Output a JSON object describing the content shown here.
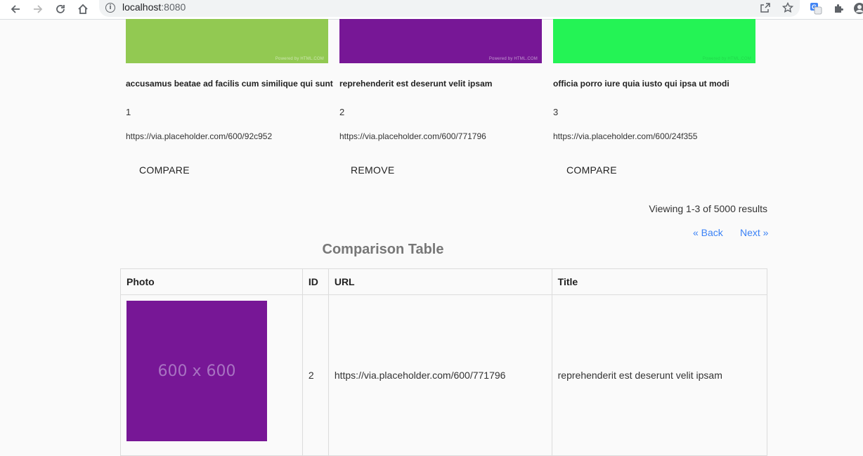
{
  "browser": {
    "url_host": "localhost",
    "url_port": ":8080"
  },
  "cards": [
    {
      "title": "accusamus beatae ad facilis cum similique qui sunt",
      "id": "1",
      "url": "https://via.placeholder.com/600/92c952",
      "button": "COMPARE",
      "color": "#92c952",
      "thumb_caption": "Powered by HTML.COM"
    },
    {
      "title": "reprehenderit est deserunt velit ipsam",
      "id": "2",
      "url": "https://via.placeholder.com/600/771796",
      "button": "REMOVE",
      "color": "#771796",
      "thumb_caption": "Powered by HTML.COM"
    },
    {
      "title": "officia porro iure quia iusto qui ipsa ut modi",
      "id": "3",
      "url": "https://via.placeholder.com/600/24f355",
      "button": "COMPARE",
      "color": "#24f355",
      "thumb_caption": "Powered by HTML.COM"
    }
  ],
  "pagination": {
    "viewing": "Viewing 1-3 of 5000 results",
    "back": "« Back",
    "next": "Next »"
  },
  "comparison": {
    "title": "Comparison Table",
    "headers": [
      "Photo",
      "ID",
      "URL",
      "Title"
    ],
    "rows": [
      {
        "photo_text": "600 x 600",
        "photo_color": "#771796",
        "id": "2",
        "url": "https://via.placeholder.com/600/771796",
        "title": "reprehenderit est deserunt velit ipsam"
      }
    ]
  },
  "icons": {
    "back": "arrow-left-icon",
    "forward": "arrow-right-icon",
    "reload": "reload-icon",
    "home": "home-icon",
    "info": "info-icon",
    "share": "share-icon",
    "bookmark": "star-icon",
    "translate": "translate-icon",
    "extensions": "puzzle-icon",
    "profile": "profile-icon"
  }
}
